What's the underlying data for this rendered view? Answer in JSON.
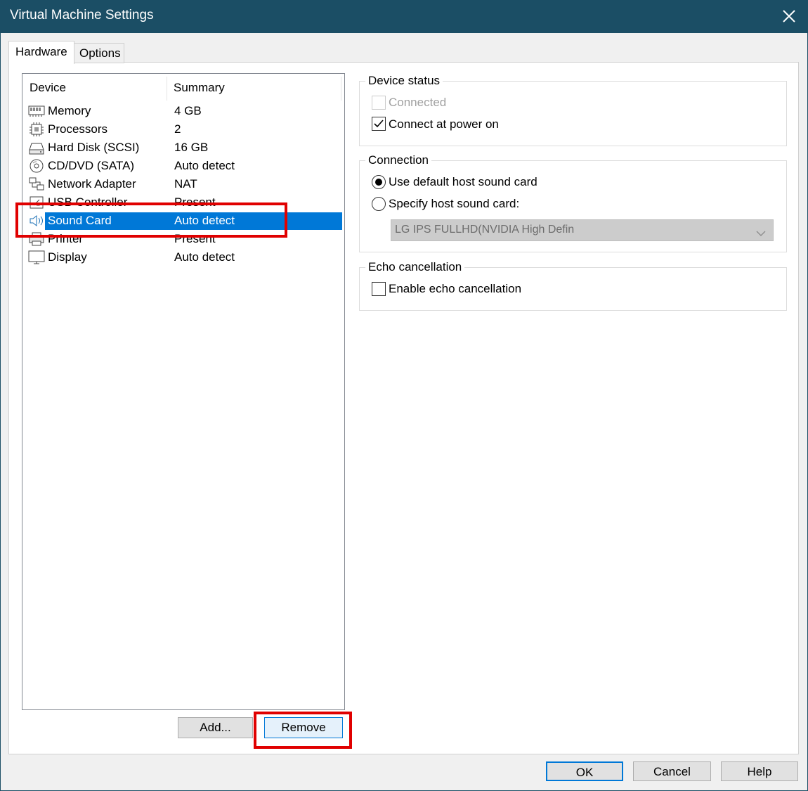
{
  "window": {
    "title": "Virtual Machine Settings"
  },
  "tabs": [
    {
      "label": "Hardware",
      "active": true
    },
    {
      "label": "Options",
      "active": false
    }
  ],
  "device_list": {
    "columns": {
      "device": "Device",
      "summary": "Summary"
    },
    "rows": [
      {
        "name": "Memory",
        "summary": "4 GB",
        "icon": "memory-icon"
      },
      {
        "name": "Processors",
        "summary": "2",
        "icon": "processor-icon"
      },
      {
        "name": "Hard Disk (SCSI)",
        "summary": "16 GB",
        "icon": "hard-disk-icon"
      },
      {
        "name": "CD/DVD (SATA)",
        "summary": "Auto detect",
        "icon": "cd-dvd-icon"
      },
      {
        "name": "Network Adapter",
        "summary": "NAT",
        "icon": "network-adapter-icon"
      },
      {
        "name": "USB Controller",
        "summary": "Present",
        "icon": "usb-controller-icon"
      },
      {
        "name": "Sound Card",
        "summary": "Auto detect",
        "icon": "sound-card-icon",
        "selected": true
      },
      {
        "name": "Printer",
        "summary": "Present",
        "icon": "printer-icon"
      },
      {
        "name": "Display",
        "summary": "Auto detect",
        "icon": "display-icon"
      }
    ]
  },
  "buttons": {
    "add": "Add...",
    "remove": "Remove",
    "ok": "OK",
    "cancel": "Cancel",
    "help": "Help"
  },
  "device_status": {
    "title": "Device status",
    "connected": {
      "label": "Connected",
      "checked": false,
      "enabled": false
    },
    "connect_at_power_on": {
      "label": "Connect at power on",
      "checked": true
    }
  },
  "connection": {
    "title": "Connection",
    "use_default": {
      "label": "Use default host sound card",
      "selected": true
    },
    "specify": {
      "label": "Specify host sound card:",
      "selected": false
    },
    "host_card_select": {
      "value": "LG IPS FULLHD(NVIDIA High Defin",
      "enabled": false
    }
  },
  "echo": {
    "title": "Echo cancellation",
    "enable": {
      "label": "Enable echo cancellation",
      "checked": false
    }
  },
  "colors": {
    "titlebar": "#1b4e65",
    "selection": "#0078d7",
    "highlight": "#e00000"
  }
}
